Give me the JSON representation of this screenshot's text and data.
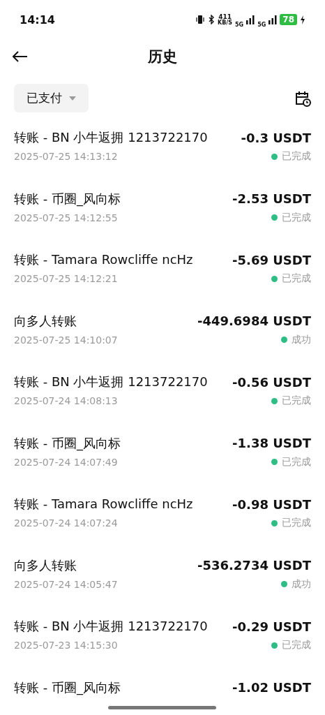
{
  "status_bar": {
    "time": "14:14",
    "speed": "411",
    "speed_unit": "KB/S",
    "sim1": "5G",
    "sim2": "5G",
    "battery": "78"
  },
  "header": {
    "title": "历史"
  },
  "filter": {
    "label": "已支付"
  },
  "transactions": [
    {
      "title": "转账 - BN 小牛返拥 1213722170",
      "amount": "-0.3 USDT",
      "time": "2025-07-25 14:13:12",
      "status": "已完成"
    },
    {
      "title": "转账 - 币圈_风向标",
      "amount": "-2.53 USDT",
      "time": "2025-07-25 14:12:55",
      "status": "已完成"
    },
    {
      "title": "转账 - Tamara Rowcliffe ncHz",
      "amount": "-5.69 USDT",
      "time": "2025-07-25 14:12:21",
      "status": "已完成"
    },
    {
      "title": "向多人转账",
      "amount": "-449.6984 USDT",
      "time": "2025-07-25 14:10:07",
      "status": "成功"
    },
    {
      "title": "转账 - BN 小牛返拥 1213722170",
      "amount": "-0.56 USDT",
      "time": "2025-07-24 14:08:13",
      "status": "已完成"
    },
    {
      "title": "转账 - 币圈_风向标",
      "amount": "-1.38 USDT",
      "time": "2025-07-24 14:07:49",
      "status": "已完成"
    },
    {
      "title": "转账 - Tamara Rowcliffe ncHz",
      "amount": "-0.98 USDT",
      "time": "2025-07-24 14:07:24",
      "status": "已完成"
    },
    {
      "title": "向多人转账",
      "amount": "-536.2734 USDT",
      "time": "2025-07-24 14:05:47",
      "status": "成功"
    },
    {
      "title": "转账 - BN 小牛返拥 1213722170",
      "amount": "-0.29 USDT",
      "time": "2025-07-23 14:15:30",
      "status": "已完成"
    },
    {
      "title": "转账 - 币圈_风向标",
      "amount": "-1.02 USDT"
    }
  ]
}
